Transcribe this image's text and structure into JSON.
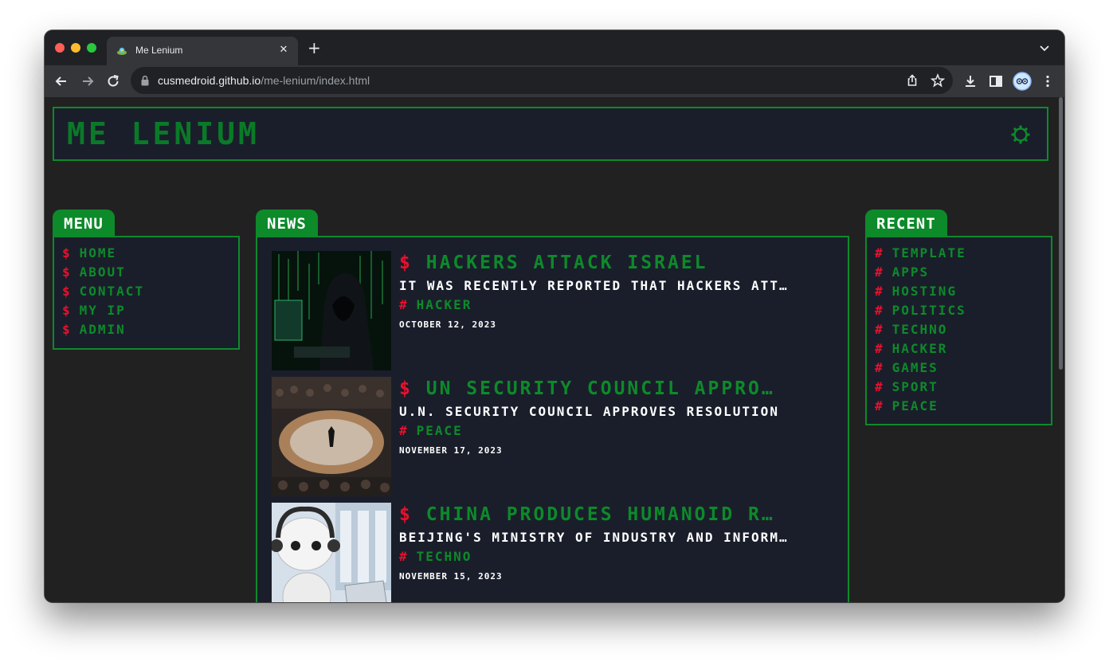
{
  "browser": {
    "tab_title": "Me Lenium",
    "url_host": "cusmedroid.github.io",
    "url_path": "/me-lenium/index.html"
  },
  "site": {
    "title": "Me Lenium"
  },
  "menu": {
    "heading": "Menu",
    "marker": "$",
    "items": [
      "Home",
      "About",
      "Contact",
      "My IP",
      "Admin"
    ]
  },
  "news": {
    "heading": "News",
    "marker": "$",
    "tag_marker": "#",
    "items": [
      {
        "title": "Hackers Attack Israel",
        "desc": "It was recently reported that hackers attacked Israel",
        "tag": "Hacker",
        "date": "October 12, 2023",
        "image": "hooded-hacker-image"
      },
      {
        "title": "UN Security Council Approves Resolution",
        "desc": "U.N. Security Council approves resolution",
        "tag": "Peace",
        "date": "November 17, 2023",
        "image": "security-council-image"
      },
      {
        "title": "China Produces Humanoid Robots",
        "desc": "Beijing's Ministry of Industry and Information",
        "tag": "Techno",
        "date": "November 15, 2023",
        "image": "humanoid-robot-image"
      }
    ]
  },
  "recent": {
    "heading": "Recent",
    "marker": "#",
    "items": [
      "Template",
      "Apps",
      "Hosting",
      "Politics",
      "Techno",
      "Hacker",
      "Games",
      "Sport",
      "Peace"
    ]
  },
  "colors": {
    "accent_green": "#0d8a2a",
    "marker_red": "#e8112d",
    "panel_bg": "#1a1e2b",
    "page_bg": "#212122"
  },
  "icons": {
    "settings": "gear-icon",
    "lock": "lock-icon",
    "back": "back-arrow-icon",
    "forward": "forward-arrow-icon",
    "reload": "reload-icon"
  }
}
